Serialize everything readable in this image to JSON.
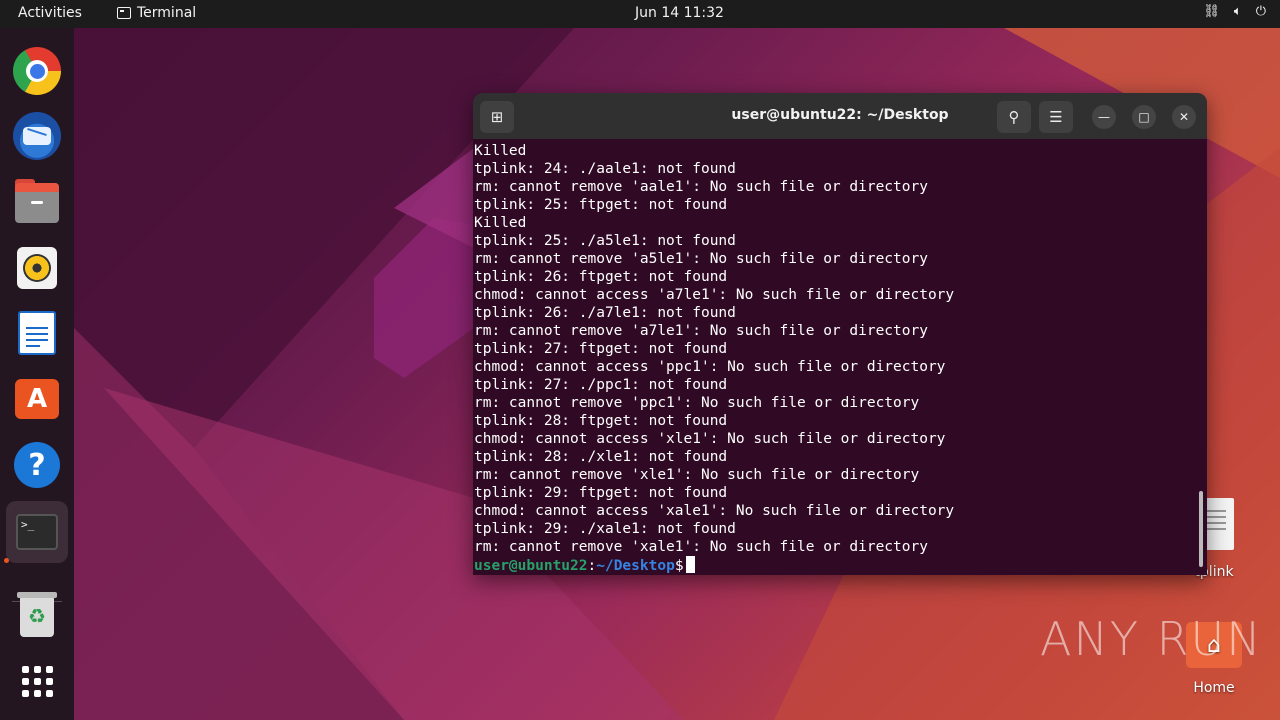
{
  "topbar": {
    "activities": "Activities",
    "app_name": "Terminal",
    "clock": "Jun 14  11:32",
    "tray_icons": [
      "network-icon",
      "volume-icon",
      "power-icon"
    ]
  },
  "dock": {
    "items": [
      {
        "name": "Google Chrome",
        "icon": "chrome-icon"
      },
      {
        "name": "Thunderbird Mail",
        "icon": "thunderbird-icon"
      },
      {
        "name": "Files",
        "icon": "files-icon"
      },
      {
        "name": "Rhythmbox",
        "icon": "rhythmbox-icon"
      },
      {
        "name": "LibreOffice Writer",
        "icon": "writer-icon"
      },
      {
        "name": "Ubuntu Software",
        "icon": "app-center-icon"
      },
      {
        "name": "Help",
        "icon": "help-icon"
      },
      {
        "name": "Terminal",
        "icon": "terminal-icon",
        "running": true
      },
      {
        "name": "Trash",
        "icon": "trash-icon"
      },
      {
        "name": "Show Applications",
        "icon": "app-grid-icon"
      }
    ],
    "terminal_glyph": ">_"
  },
  "terminal": {
    "title": "user@ubuntu22: ~/Desktop",
    "lines": [
      "Killed",
      "tplink: 24: ./aale1: not found",
      "rm: cannot remove 'aale1': No such file or directory",
      "tplink: 25: ftpget: not found",
      "Killed",
      "tplink: 25: ./a5le1: not found",
      "rm: cannot remove 'a5le1': No such file or directory",
      "tplink: 26: ftpget: not found",
      "chmod: cannot access 'a7le1': No such file or directory",
      "tplink: 26: ./a7le1: not found",
      "rm: cannot remove 'a7le1': No such file or directory",
      "tplink: 27: ftpget: not found",
      "chmod: cannot access 'ppc1': No such file or directory",
      "tplink: 27: ./ppc1: not found",
      "rm: cannot remove 'ppc1': No such file or directory",
      "tplink: 28: ftpget: not found",
      "chmod: cannot access 'xle1': No such file or directory",
      "tplink: 28: ./xle1: not found",
      "rm: cannot remove 'xle1': No such file or directory",
      "tplink: 29: ftpget: not found",
      "chmod: cannot access 'xale1': No such file or directory",
      "tplink: 29: ./xale1: not found",
      "rm: cannot remove 'xale1': No such file or directory"
    ],
    "prompt_user": "user@ubuntu22",
    "prompt_sep": ":",
    "prompt_path": "~/Desktop",
    "prompt_symbol": "$"
  },
  "desktop": {
    "icons": [
      {
        "label": "tplink",
        "icon": "text-file-icon"
      },
      {
        "label": "Home",
        "icon": "home-folder-icon"
      }
    ]
  },
  "watermark": "ANY RUN",
  "colors": {
    "terminal_bg": "#300a24",
    "prompt_user": "#26a269",
    "prompt_path": "#3584e4",
    "accent": "#e95420"
  }
}
